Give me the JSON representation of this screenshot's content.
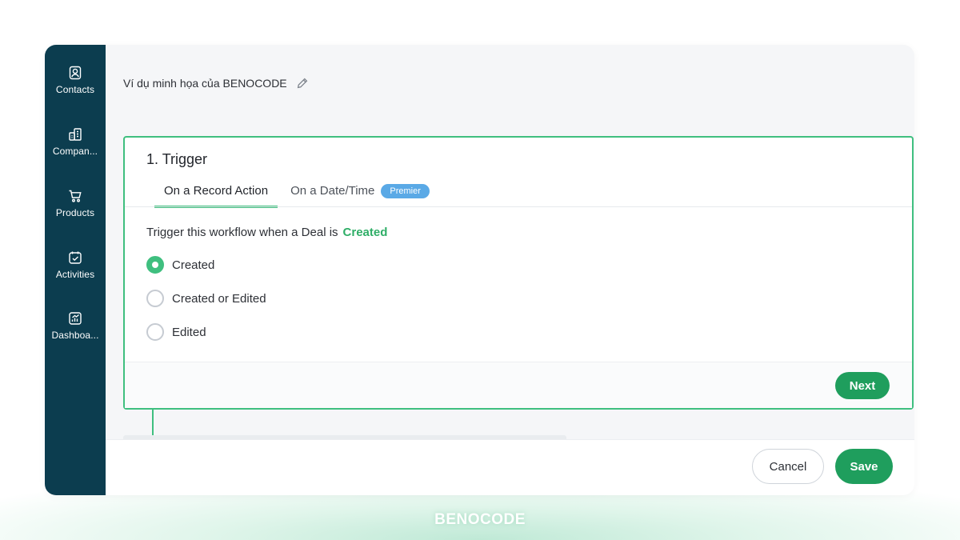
{
  "sidebar": {
    "items": [
      {
        "label": "Contacts",
        "icon": "contact-icon"
      },
      {
        "label": "Compan...",
        "icon": "building-icon"
      },
      {
        "label": "Products",
        "icon": "cart-icon"
      },
      {
        "label": "Activities",
        "icon": "calendar-check-icon"
      },
      {
        "label": "Dashboa...",
        "icon": "chart-icon"
      }
    ]
  },
  "header": {
    "title": "Ví dụ minh họa của BENOCODE",
    "edit_icon": "pencil-icon"
  },
  "trigger": {
    "title": "1. Trigger",
    "tabs": [
      {
        "label": "On a Record Action",
        "active": true
      },
      {
        "label": "On a Date/Time",
        "badge": "Premier"
      }
    ],
    "description": "Trigger this workflow when a Deal is",
    "selected_value": "Created",
    "options": [
      {
        "label": "Created",
        "checked": true
      },
      {
        "label": "Created or Edited",
        "checked": false
      },
      {
        "label": "Edited",
        "checked": false
      }
    ],
    "next_label": "Next"
  },
  "footer": {
    "cancel_label": "Cancel",
    "save_label": "Save"
  },
  "watermark": "BENOCODE",
  "colors": {
    "sidebar_bg": "#0c3d4f",
    "accent_green": "#3fbf7f",
    "button_green": "#1f9e5d",
    "premium_blue": "#5aa9e6"
  }
}
